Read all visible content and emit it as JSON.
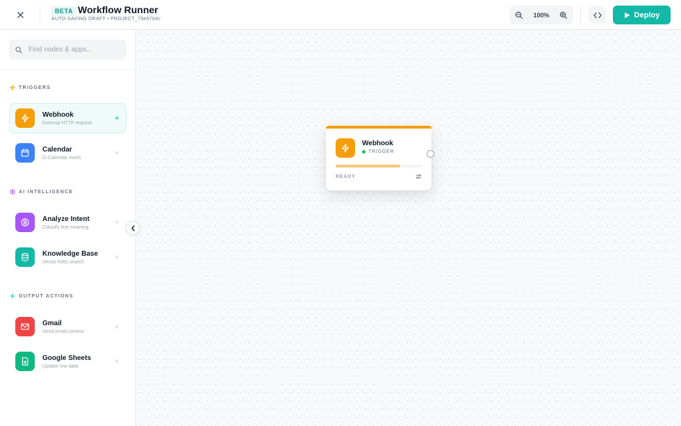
{
  "header": {
    "badge": "BETA",
    "title": "Workflow Runner",
    "subtitle": "AUTO-SAVING DRAFT • PROJECT_76e5784c",
    "zoom": "100%",
    "deploy_label": "Deploy"
  },
  "sidebar": {
    "search_placeholder": "Find nodes & apps...",
    "sections": [
      {
        "title": "TRIGGERS",
        "items": [
          {
            "name": "Webhook",
            "desc": "External HTTP request",
            "icon": "lightning-icon",
            "color": "#f59e0b"
          },
          {
            "name": "Calendar",
            "desc": "G-Calendar event",
            "icon": "calendar-icon",
            "color": "#3b82f6"
          }
        ]
      },
      {
        "title": "AI INTELLIGENCE",
        "items": [
          {
            "name": "Analyze Intent",
            "desc": "Classify text meaning",
            "icon": "brain-icon",
            "color": "#a855f7"
          },
          {
            "name": "Knowledge Base",
            "desc": "Vector RAG search",
            "icon": "database-icon",
            "color": "#14b8a6"
          }
        ]
      },
      {
        "title": "OUTPUT ACTIONS",
        "items": [
          {
            "name": "Gmail",
            "desc": "Send email context",
            "icon": "mail-icon",
            "color": "#ef4444"
          },
          {
            "name": "Google Sheets",
            "desc": "Update row data",
            "icon": "sheet-icon",
            "color": "#10b981"
          }
        ]
      }
    ]
  },
  "canvas": {
    "node": {
      "name": "Webhook",
      "type": "TRIGGER",
      "status": "READY",
      "progress": 0.75,
      "accent": "#f59e0b"
    }
  },
  "colors": {
    "accent": "#14b8a6",
    "trigger": "#f59e0b",
    "ai": "#a855f7"
  }
}
